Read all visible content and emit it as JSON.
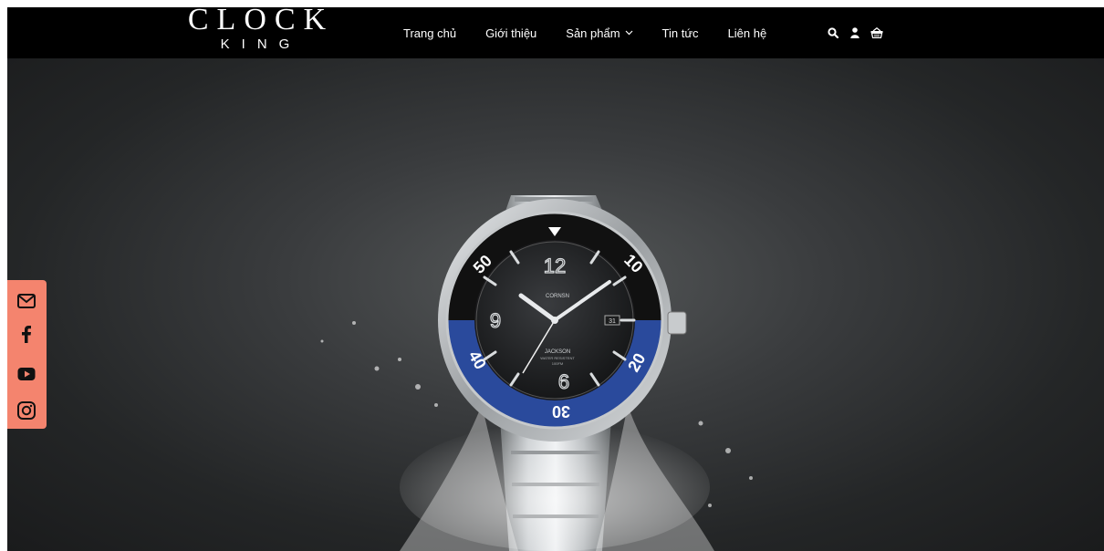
{
  "brand": {
    "logo_main": "CLOCK",
    "logo_sub": "KING"
  },
  "nav": {
    "items": [
      {
        "label": "Trang chủ"
      },
      {
        "label": "Giới thiệu"
      },
      {
        "label": "Sản phẩm",
        "has_dropdown": true
      },
      {
        "label": "Tin tức"
      },
      {
        "label": "Liên hệ"
      }
    ],
    "icons": [
      "search-icon",
      "user-icon",
      "cart-icon"
    ]
  },
  "hero": {
    "watch_brand": "CORNSN",
    "watch_model": "JACKSON",
    "watch_line1": "WATER RESISTENT",
    "watch_line2": "100FM",
    "date": "31",
    "dial_numbers": [
      "12",
      "9",
      "6"
    ],
    "bezel_numbers": [
      "50",
      "10",
      "40",
      "20",
      "30"
    ]
  },
  "social": {
    "icons": [
      "email-icon",
      "facebook-icon",
      "youtube-icon",
      "instagram-icon"
    ]
  },
  "colors": {
    "navbar_bg": "#000000",
    "social_bg": "#f4846e",
    "bezel_blue": "#2a4a9c",
    "bezel_black": "#111111"
  }
}
